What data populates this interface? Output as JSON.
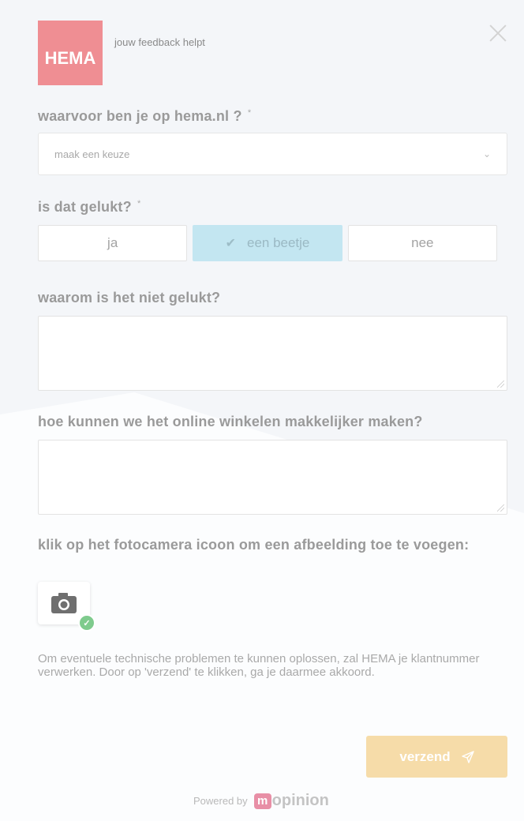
{
  "header": {
    "logo_text": "HEMA",
    "tagline": "jouw feedback helpt"
  },
  "q1": {
    "label": "waarvoor ben je op hema.nl ?",
    "required": "*",
    "select_value": "maak een keuze"
  },
  "q2": {
    "label": "is dat gelukt?",
    "required": "*",
    "options": [
      {
        "label": "ja"
      },
      {
        "label": "een beetje"
      },
      {
        "label": "nee"
      }
    ],
    "selected": "een beetje"
  },
  "q3": {
    "label": "waarom is het niet gelukt?"
  },
  "q4": {
    "label": "hoe kunnen we het online winkelen makkelijker maken?"
  },
  "q5": {
    "label": "klik op het fotocamera icoon om een afbeelding toe te voegen:"
  },
  "note": "Om eventuele technische problemen te kunnen oplossen, zal HEMA je klantnummer verwerken. Door op 'verzend' te klikken, ga je daarmee akkoord.",
  "submit": {
    "label": "verzend"
  },
  "footer": {
    "powered_by": "Powered by",
    "brand_m": "m",
    "brand_rest": "opinion"
  },
  "colors": {
    "logo": "#ef8e93",
    "selected_option": "#c3e6f1",
    "submit": "#f6dca9",
    "badge": "#7fcb8d"
  },
  "icons": {
    "close": "close-icon",
    "chevron": "chevron-down-icon",
    "check": "check-icon",
    "camera": "camera-icon",
    "send": "send-icon"
  }
}
